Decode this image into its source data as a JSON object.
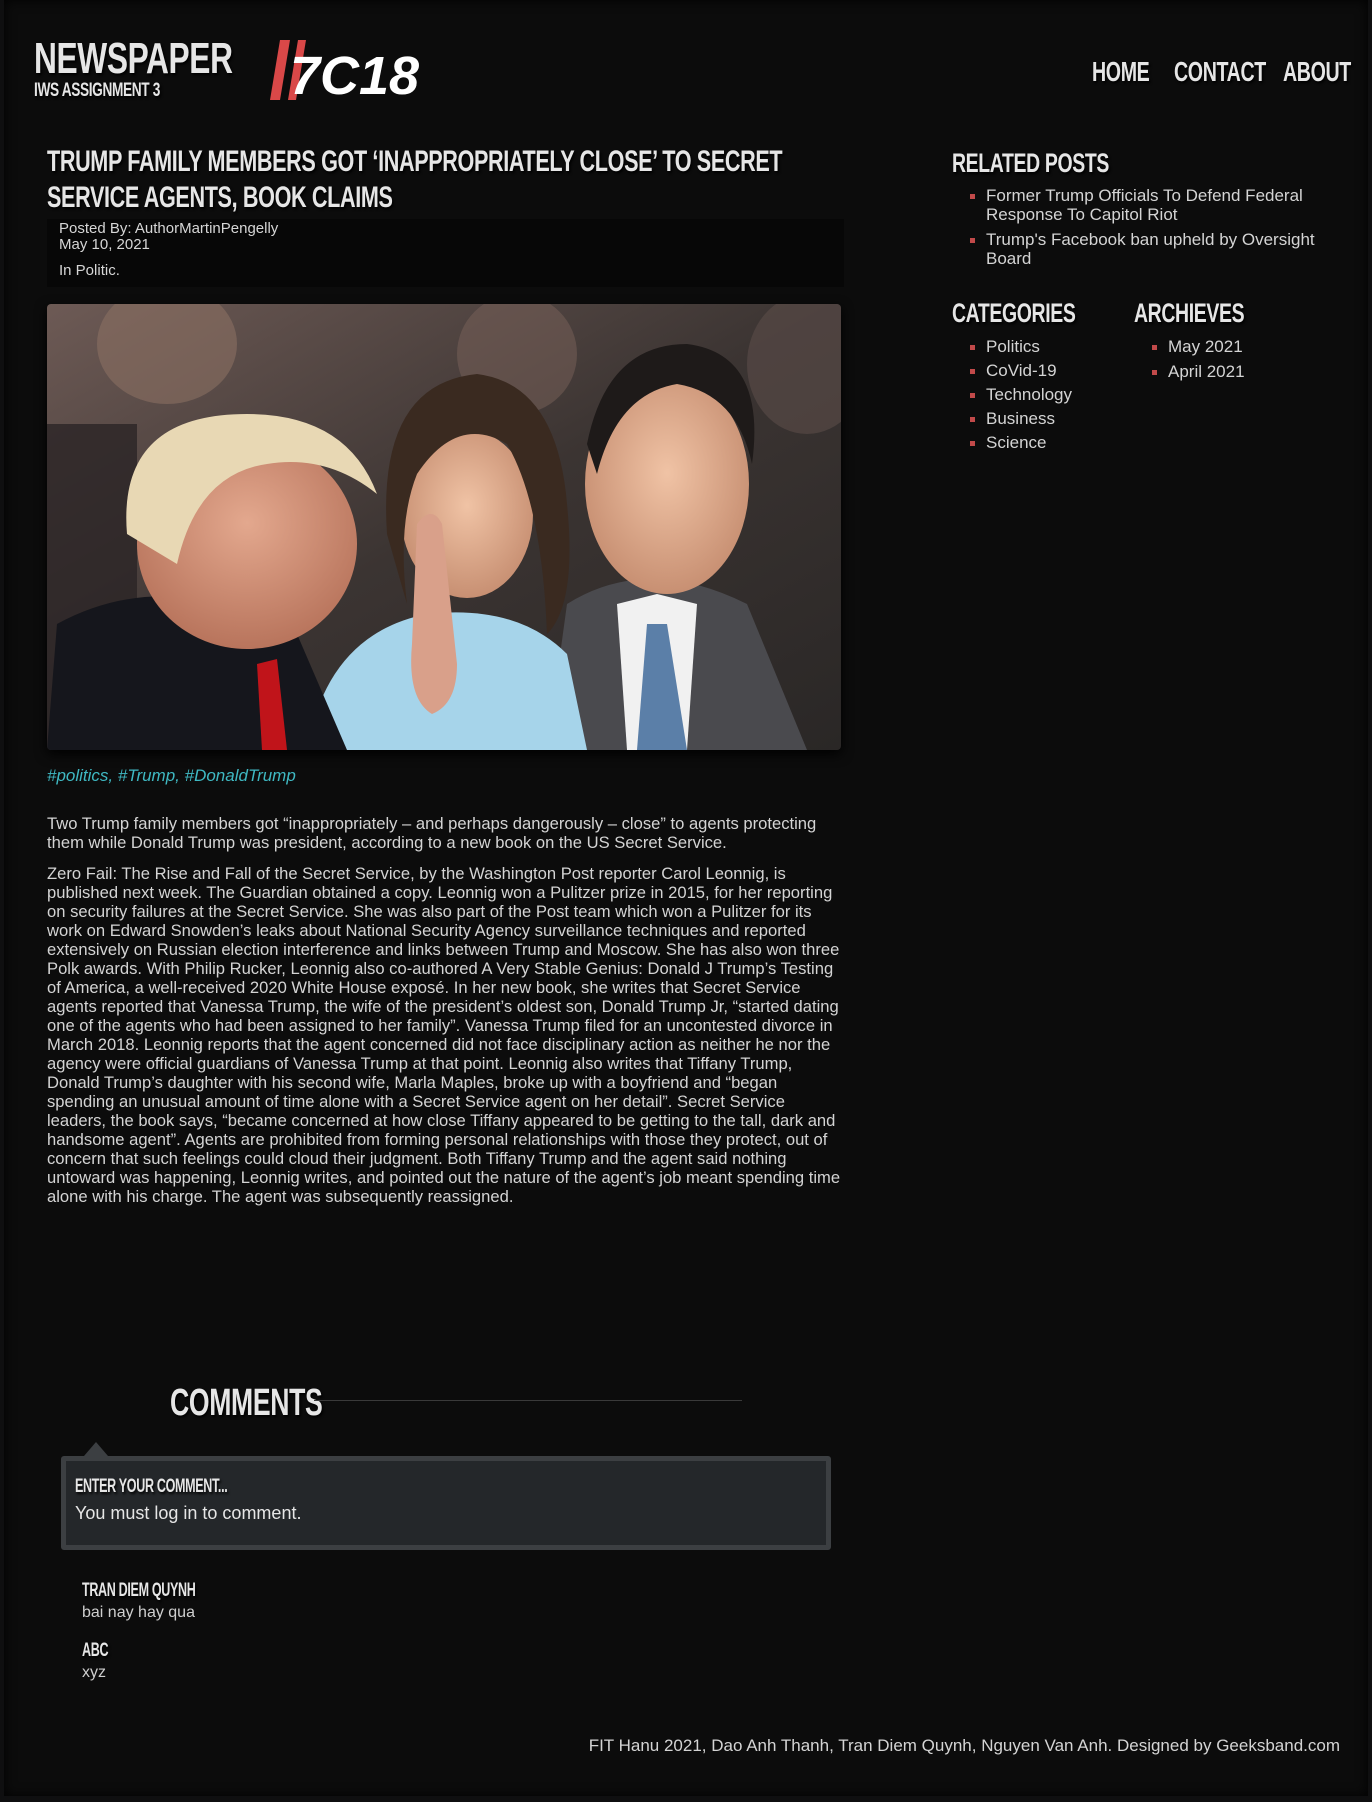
{
  "header": {
    "site_title": "NEWSPAPER",
    "site_subtitle": "IWS ASSIGNMENT 3",
    "logo_text": "7C18",
    "nav": {
      "home": "HOME",
      "contact": "CONTACT",
      "about": "ABOUT"
    }
  },
  "article": {
    "title": "TRUMP FAMILY MEMBERS GOT ‘INAPPROPRIATELY CLOSE’ TO SECRET SERVICE AGENTS, BOOK CLAIMS",
    "posted_by": "Posted By: AuthorMartinPengelly",
    "date": "May 10, 2021",
    "category": "In Politic.",
    "tags": "#politics, #Trump, #DonaldTrump",
    "paragraphs": [
      "Two Trump family members got “inappropriately – and perhaps dangerously – close” to agents protecting them while Donald Trump was president, according to a new book on the US Secret Service.",
      "Zero Fail: The Rise and Fall of the Secret Service, by the Washington Post reporter Carol Leonnig, is published next week. The Guardian obtained a copy. Leonnig won a Pulitzer prize in 2015, for her reporting on security failures at the Secret Service. She was also part of the Post team which won a Pulitzer for its work on Edward Snowden’s leaks about National Security Agency surveillance techniques and reported extensively on Russian election interference and links between Trump and Moscow. She has also won three Polk awards. With Philip Rucker, Leonnig also co-authored A Very Stable Genius: Donald J Trump’s Testing of America, a well-received 2020 White House exposé. In her new book, she writes that Secret Service agents reported that Vanessa Trump, the wife of the president’s oldest son, Donald Trump Jr, “started dating one of the agents who had been assigned to her family”. Vanessa Trump filed for an uncontested divorce in March 2018. Leonnig reports that the agent concerned did not face disciplinary action as neither he nor the agency were official guardians of Vanessa Trump at that point. Leonnig also writes that Tiffany Trump, Donald Trump’s daughter with his second wife, Marla Maples, broke up with a boyfriend and “began spending an unusual amount of time alone with a Secret Service agent on her detail”. Secret Service leaders, the book says, “became concerned at how close Tiffany appeared to be getting to the tall, dark and handsome agent”. Agents are prohibited from forming personal relationships with those they protect, out of concern that such feelings could cloud their judgment. Both Tiffany Trump and the agent said nothing untoward was happening, Leonnig writes, and pointed out the nature of the agent’s job meant spending time alone with his charge. The agent was subsequently reassigned."
    ]
  },
  "sidebar": {
    "related_title": "RELATED POSTS",
    "related": [
      "Former Trump Officials To Defend Federal Response To Capitol Riot",
      "Trump's Facebook ban upheld by Oversight Board"
    ],
    "categories_title": "CATEGORIES",
    "categories": [
      "Politics",
      "CoVid-19",
      "Technology",
      "Business",
      "Science"
    ],
    "archives_title": "ARCHIEVES",
    "archives": [
      "May 2021",
      "April 2021"
    ]
  },
  "comments": {
    "title": "COMMENTS",
    "box_label": "ENTER YOUR COMMENT...",
    "login_msg": "You must log in to comment.",
    "items": [
      {
        "author": "TRAN DIEM QUYNH",
        "text": "bai nay hay qua"
      },
      {
        "author": "ABC",
        "text": "xyz"
      }
    ]
  },
  "footer": {
    "text": "FIT Hanu 2021, Dao Anh Thanh, Tran Diem Quynh, Nguyen Van Anh. Designed by Geeksband.com"
  },
  "colors": {
    "background": "#0c0c0c",
    "accent_red": "#c24a4a",
    "tag_teal": "#3fb9c3",
    "comment_box": "#24272a"
  }
}
